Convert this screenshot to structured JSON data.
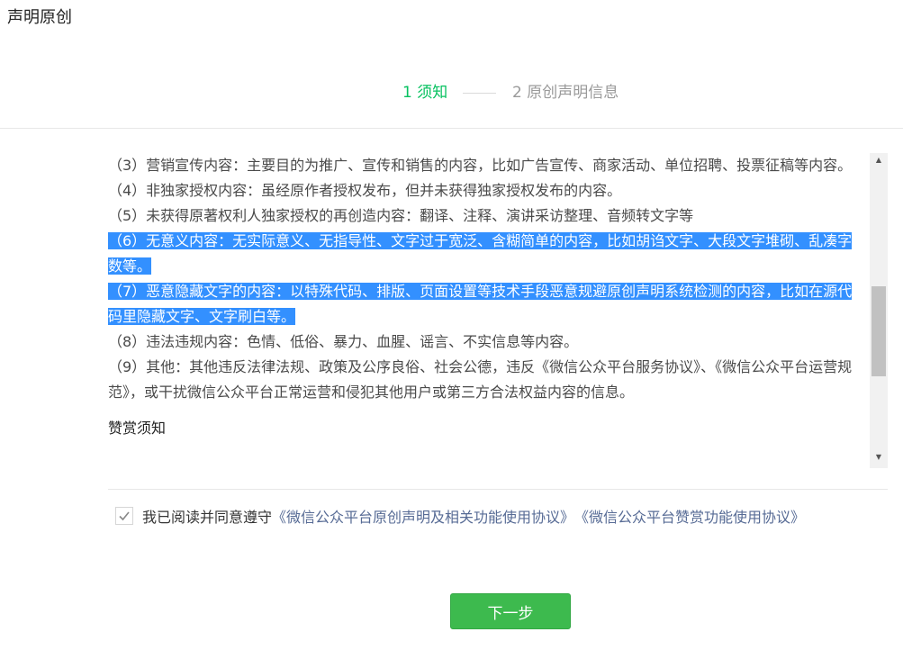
{
  "page": {
    "title": "声明原创"
  },
  "steps": [
    {
      "label": "1 须知",
      "active": true
    },
    {
      "label": "2 原创声明信息",
      "active": false
    }
  ],
  "notice": {
    "items": [
      {
        "text": "（3）营销宣传内容：主要目的为推广、宣传和销售的内容，比如广告宣传、商家活动、单位招聘、投票征稿等内容。",
        "selected": false
      },
      {
        "text": "（4）非独家授权内容：虽经原作者授权发布，但并未获得独家授权发布的内容。",
        "selected": false
      },
      {
        "text": "（5）未获得原著权利人独家授权的再创造内容：翻译、注释、演讲采访整理、音频转文字等",
        "selected": false
      },
      {
        "text": "（6）无意义内容：无实际意义、无指导性、文字过于宽泛、含糊简单的内容，比如胡诌文字、大段文字堆砌、乱凑字数等。",
        "selected": true
      },
      {
        "text": "（7）恶意隐藏文字的内容：以特殊代码、排版、页面设置等技术手段恶意规避原创声明系统检测的内容，比如在源代码里隐藏文字、文字刷白等。",
        "selected": true
      },
      {
        "text": "（8）违法违规内容：色情、低俗、暴力、血腥、谣言、不实信息等内容。",
        "selected": false
      },
      {
        "text": "（9）其他：其他违反法律法规、政策及公序良俗、社会公德，违反《微信公众平台服务协议》、《微信公众平台运营规范》，或干扰微信公众平台正常运营和侵犯其他用户或第三方合法权益内容的信息。",
        "selected": false
      }
    ],
    "next_section_heading": "赞赏须知"
  },
  "agreement": {
    "checked": true,
    "prefix": "我已阅读并同意遵守",
    "link1": "《微信公众平台原创声明及相关功能使用协议》",
    "link2": "《微信公众平台赞赏功能使用协议》"
  },
  "actions": {
    "next_label": "下一步"
  },
  "colors": {
    "accent": "#07c160",
    "link": "#576b95",
    "selection": "#3390ff",
    "button": "#3dba4e"
  }
}
